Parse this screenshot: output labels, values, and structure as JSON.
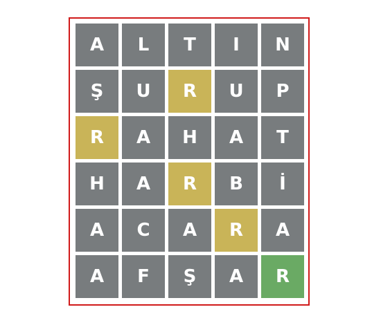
{
  "colors": {
    "absent": "#787c7e",
    "present": "#c9b458",
    "correct": "#6aaa64",
    "frame": "#d01a1a"
  },
  "board": {
    "rows": [
      [
        {
          "letter": "A",
          "state": "absent"
        },
        {
          "letter": "L",
          "state": "absent"
        },
        {
          "letter": "T",
          "state": "absent"
        },
        {
          "letter": "I",
          "state": "absent"
        },
        {
          "letter": "N",
          "state": "absent"
        }
      ],
      [
        {
          "letter": "Ş",
          "state": "absent"
        },
        {
          "letter": "U",
          "state": "absent"
        },
        {
          "letter": "R",
          "state": "present"
        },
        {
          "letter": "U",
          "state": "absent"
        },
        {
          "letter": "P",
          "state": "absent"
        }
      ],
      [
        {
          "letter": "R",
          "state": "present"
        },
        {
          "letter": "A",
          "state": "absent"
        },
        {
          "letter": "H",
          "state": "absent"
        },
        {
          "letter": "A",
          "state": "absent"
        },
        {
          "letter": "T",
          "state": "absent"
        }
      ],
      [
        {
          "letter": "H",
          "state": "absent"
        },
        {
          "letter": "A",
          "state": "absent"
        },
        {
          "letter": "R",
          "state": "present"
        },
        {
          "letter": "B",
          "state": "absent"
        },
        {
          "letter": "İ",
          "state": "absent"
        }
      ],
      [
        {
          "letter": "A",
          "state": "absent"
        },
        {
          "letter": "C",
          "state": "absent"
        },
        {
          "letter": "A",
          "state": "absent"
        },
        {
          "letter": "R",
          "state": "present"
        },
        {
          "letter": "A",
          "state": "absent"
        }
      ],
      [
        {
          "letter": "A",
          "state": "absent"
        },
        {
          "letter": "F",
          "state": "absent"
        },
        {
          "letter": "Ş",
          "state": "absent"
        },
        {
          "letter": "A",
          "state": "absent"
        },
        {
          "letter": "R",
          "state": "correct"
        }
      ]
    ]
  }
}
